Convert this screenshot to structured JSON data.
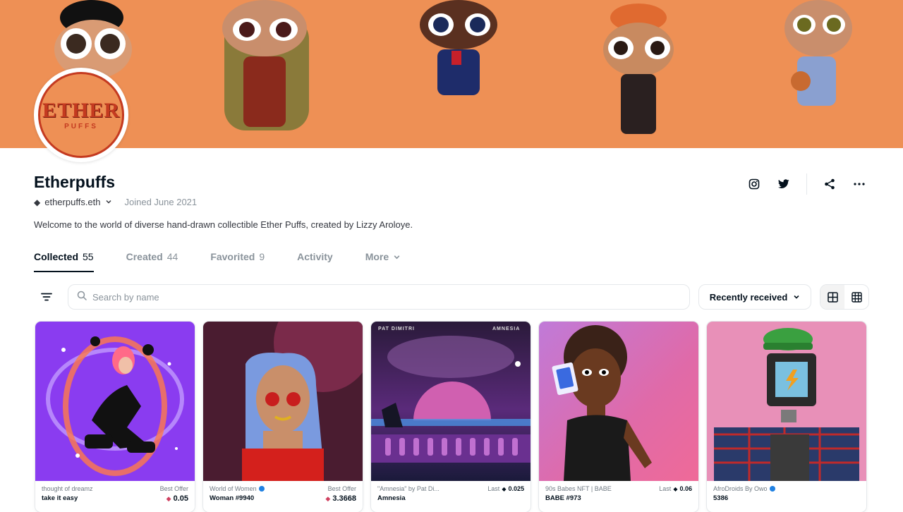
{
  "profile": {
    "name": "Etherpuffs",
    "ens": "etherpuffs.eth",
    "joined": "Joined June 2021",
    "description": "Welcome to the world of diverse hand-drawn collectible Ether Puffs, created by Lizzy Aroloye.",
    "logo_top": "ETHER",
    "logo_bottom": "PUFFS"
  },
  "colors": {
    "banner": "#ee9055",
    "accent_text": "#04111d",
    "muted_text": "#8a939b",
    "verified": "#2081e2"
  },
  "social": {
    "instagram": "instagram-icon",
    "twitter": "twitter-icon",
    "share": "share-icon",
    "more": "more-icon"
  },
  "tabs": [
    {
      "label": "Collected",
      "count": "55"
    },
    {
      "label": "Created",
      "count": "44"
    },
    {
      "label": "Favorited",
      "count": "9"
    },
    {
      "label": "Activity",
      "count": ""
    },
    {
      "label": "More",
      "count": ""
    }
  ],
  "filters": {
    "search_placeholder": "Search by name",
    "sort_label": "Recently received"
  },
  "cards": [
    {
      "collection": "thought of dreamz",
      "name": "take it easy",
      "price_label": "Best Offer",
      "price": "0.05",
      "verified": false
    },
    {
      "collection": "World of Women",
      "name": "Woman #9940",
      "price_label": "Best Offer",
      "price": "3.3668",
      "verified": true
    },
    {
      "collection": "\"Amnesia\" by Pat Di...",
      "name": "Amnesia",
      "price_label": "Last",
      "price": "0.025",
      "verified": false,
      "art_left": "PAT DIMITRI",
      "art_right": "AMNESIA"
    },
    {
      "collection": "90s Babes NFT | BABE",
      "name": "BABE #973",
      "price_label": "Last",
      "price": "0.06",
      "verified": false
    },
    {
      "collection": "AfroDroids By Owo",
      "name": "5386",
      "price_label": "",
      "price": "",
      "verified": true
    }
  ]
}
